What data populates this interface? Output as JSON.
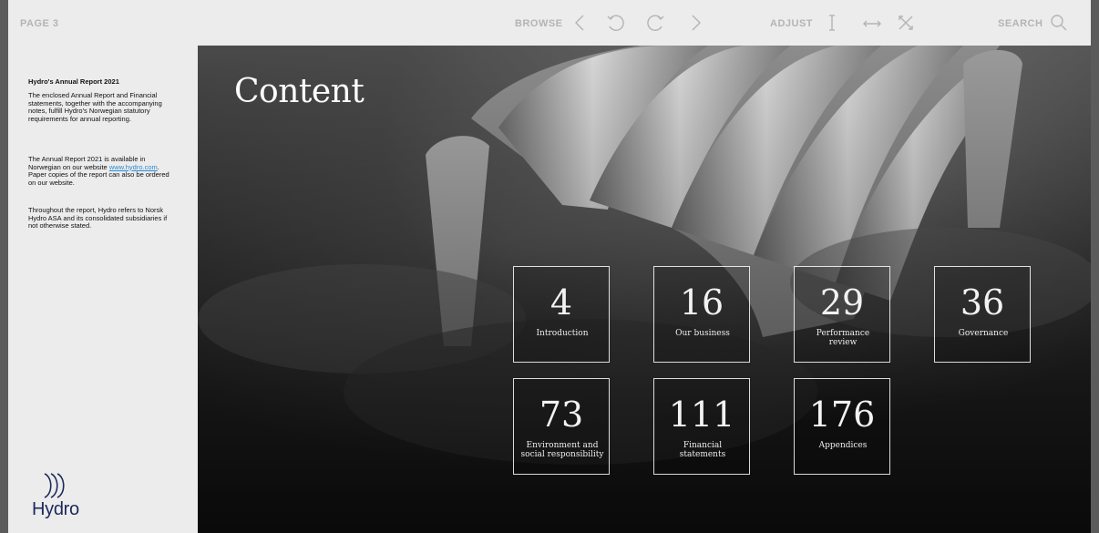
{
  "toolbar": {
    "page_label": "PAGE 3",
    "browse_label": "BROWSE",
    "adjust_label": "ADJUST",
    "search_label": "SEARCH"
  },
  "sidebar": {
    "title": "Hydro's Annual Report 2021",
    "para1": "The enclosed Annual Report and Financial statements, together with the accompanying notes, fulfill Hydro's Norwegian statutory requirements for annual reporting.",
    "para2_before": "The Annual Report 2021 is available in Norwegian on our website ",
    "para2_link": "www.hydro.com",
    "para2_after": ". Paper copies of the report can also be ordered on our website.",
    "para3": "Throughout the report, Hydro refers to Norsk Hydro ASA and its consolidated subsidiaries if not otherwise stated.",
    "logo_text": "Hydro"
  },
  "main": {
    "title": "Content",
    "tiles": [
      {
        "number": "4",
        "label": "Introduction"
      },
      {
        "number": "16",
        "label": "Our business"
      },
      {
        "number": "29",
        "label": "Performance review"
      },
      {
        "number": "36",
        "label": "Governance"
      },
      {
        "number": "73",
        "label": "Environment and social responsibility"
      },
      {
        "number": "111",
        "label": "Financial statements"
      },
      {
        "number": "176",
        "label": "Appendices"
      }
    ]
  },
  "icons": [
    "chevron-left-icon",
    "rotate-ccw-icon",
    "rotate-cw-icon",
    "chevron-right-icon",
    "fit-height-icon",
    "fit-width-icon",
    "fullscreen-icon",
    "search-icon"
  ],
  "colors": {
    "toolbar_text": "#b4b4b4",
    "page_bg": "#ececec",
    "logo": "#1c2a5a",
    "link": "#2a8ad6"
  }
}
